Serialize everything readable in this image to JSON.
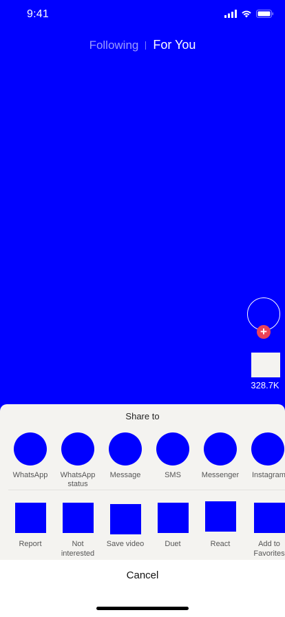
{
  "status_bar": {
    "time": "9:41"
  },
  "top_tabs": {
    "following": "Following",
    "for_you": "For You"
  },
  "right_rail": {
    "like_count": "328.7K",
    "follow_symbol": "+"
  },
  "share_sheet": {
    "title": "Share to",
    "share_targets": [
      {
        "label": "WhatsApp",
        "icon": "whatsapp-icon"
      },
      {
        "label": "WhatsApp status",
        "icon": "whatsapp-status-icon"
      },
      {
        "label": "Message",
        "icon": "message-icon"
      },
      {
        "label": "SMS",
        "icon": "sms-icon"
      },
      {
        "label": "Messenger",
        "icon": "messenger-icon"
      },
      {
        "label": "Instagram",
        "icon": "instagram-icon"
      }
    ],
    "actions": [
      {
        "label": "Report",
        "icon": "report-icon"
      },
      {
        "label": "Not interested",
        "icon": "not-interested-icon"
      },
      {
        "label": "Save video",
        "icon": "save-video-icon"
      },
      {
        "label": "Duet",
        "icon": "duet-icon"
      },
      {
        "label": "React",
        "icon": "react-icon"
      },
      {
        "label": "Add to Favorites",
        "icon": "favorites-icon"
      }
    ],
    "cancel_label": "Cancel"
  },
  "colors": {
    "background": "#0000ff",
    "sheet": "#f4f3f0",
    "accent_red": "#ea4359"
  }
}
